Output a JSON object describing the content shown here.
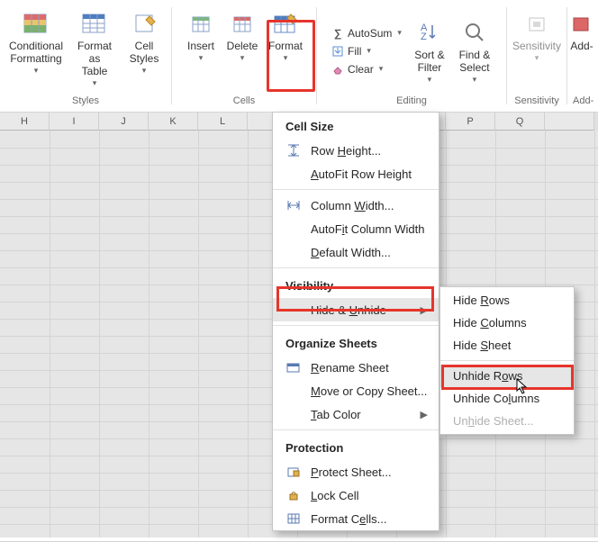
{
  "ribbon": {
    "styles_group_label": "Styles",
    "cells_group_label": "Cells",
    "editing_group_label": "Editing",
    "sensitivity_group_label": "Sensitivity",
    "addins_group_label": "Add-",
    "conditional_formatting": "Conditional\nFormatting",
    "format_as_table": "Format as\nTable",
    "cell_styles": "Cell\nStyles",
    "insert": "Insert",
    "delete": "Delete",
    "format": "Format",
    "autosum": "AutoSum",
    "fill": "Fill",
    "clear": "Clear",
    "sort_filter": "Sort &\nFilter",
    "find_select": "Find &\nSelect",
    "sensitivity": "Sensitivity",
    "addins": "Add-"
  },
  "columns": [
    "H",
    "I",
    "J",
    "K",
    "L",
    "",
    "",
    "",
    "",
    "P",
    "Q",
    ""
  ],
  "format_menu": {
    "cell_size": "Cell Size",
    "row_height": "Row Height...",
    "autofit_row_height": "AutoFit Row Height",
    "column_width": "Column Width...",
    "autofit_column_width": "AutoFit Column Width",
    "default_width": "Default Width...",
    "visibility": "Visibility",
    "hide_unhide": "Hide & Unhide",
    "organize_sheets": "Organize Sheets",
    "rename_sheet": "Rename Sheet",
    "move_copy": "Move or Copy Sheet...",
    "tab_color": "Tab Color",
    "protection": "Protection",
    "protect_sheet": "Protect Sheet...",
    "lock_cell": "Lock Cell",
    "format_cells": "Format Cells..."
  },
  "hide_submenu": {
    "hide_rows": "Hide Rows",
    "hide_columns": "Hide Columns",
    "hide_sheet": "Hide Sheet",
    "unhide_rows": "Unhide Rows",
    "unhide_columns": "Unhide Columns",
    "unhide_sheet": "Unhide Sheet..."
  }
}
